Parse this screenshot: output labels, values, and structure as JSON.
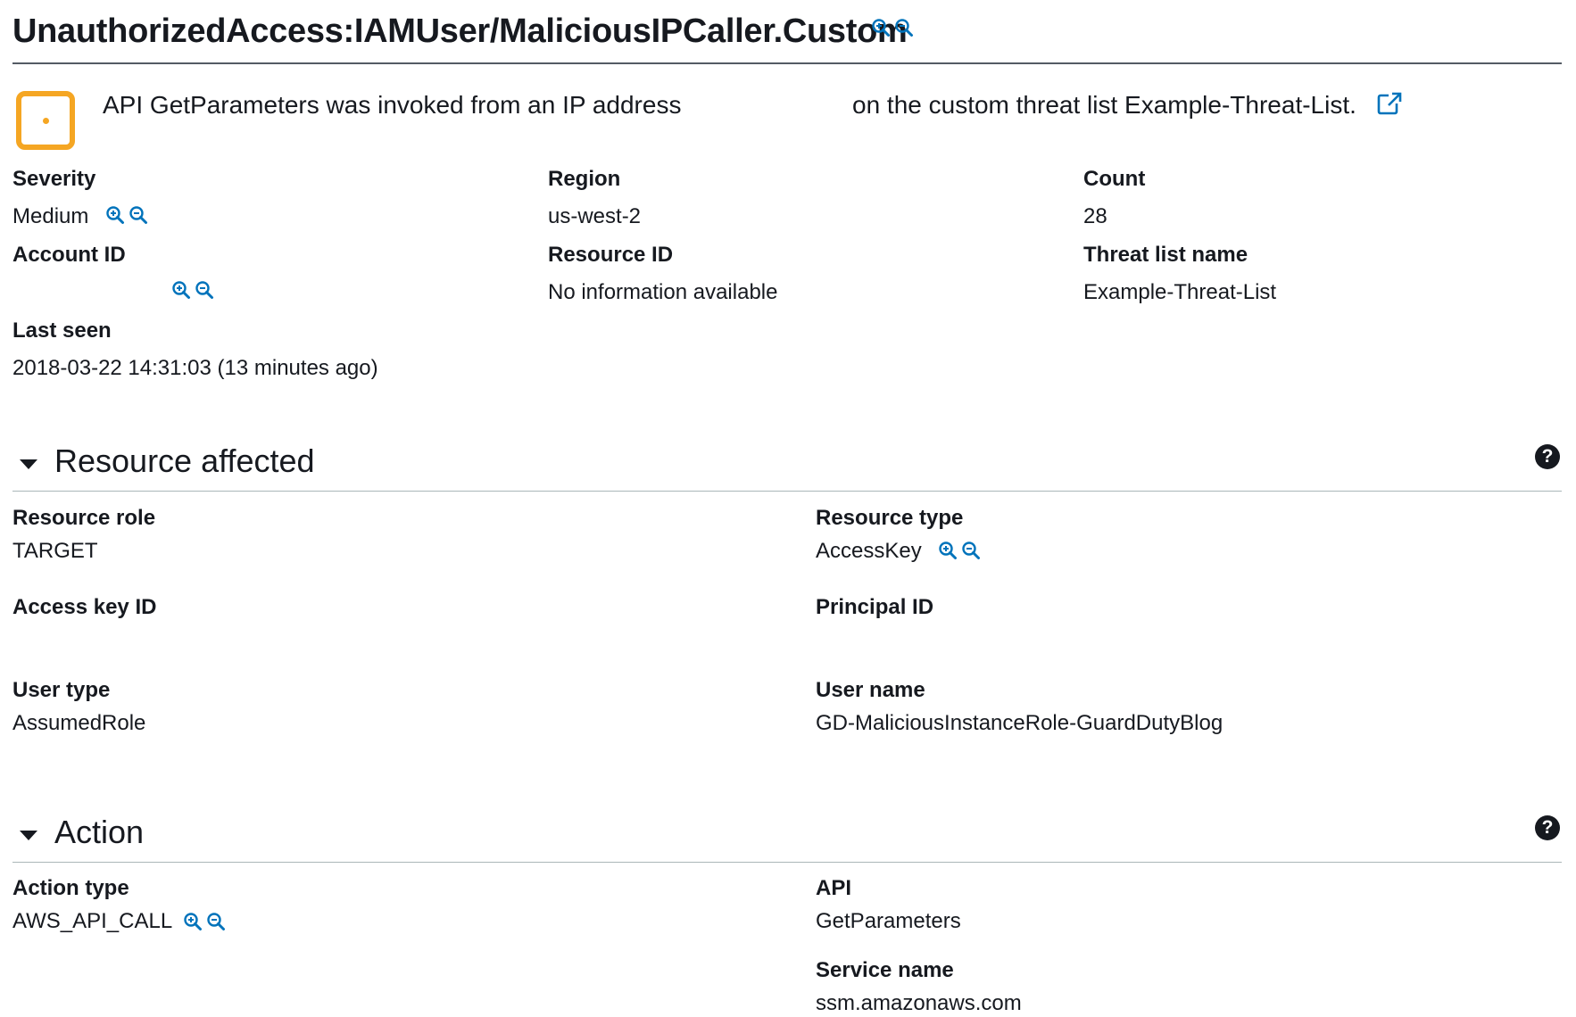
{
  "finding": {
    "title": "UnauthorizedAccess:IAMUser/MaliciousIPCaller.Custom",
    "description_part1": "API GetParameters was invoked from an IP address",
    "description_part2": "on the custom threat list Example-Threat-List.",
    "colors": {
      "severity_medium": "#f5a623",
      "link_blue": "#0073bb"
    }
  },
  "summary": {
    "severity_label": "Severity",
    "severity_value": "Medium",
    "region_label": "Region",
    "region_value": "us-west-2",
    "count_label": "Count",
    "count_value": "28",
    "account_id_label": "Account ID",
    "account_id_value": "",
    "resource_id_label": "Resource ID",
    "resource_id_value": "No information available",
    "threat_list_label": "Threat list name",
    "threat_list_value": "Example-Threat-List",
    "last_seen_label": "Last seen",
    "last_seen_value": "2018-03-22 14:31:03 (13 minutes ago)"
  },
  "resource_section": {
    "title": "Resource affected",
    "help": "?",
    "resource_role_label": "Resource role",
    "resource_role_value": "TARGET",
    "resource_type_label": "Resource type",
    "resource_type_value": "AccessKey",
    "access_key_id_label": "Access key ID",
    "access_key_id_value": "",
    "principal_id_label": "Principal ID",
    "principal_id_value": "",
    "user_type_label": "User type",
    "user_type_value": "AssumedRole",
    "user_name_label": "User name",
    "user_name_value": "GD-MaliciousInstanceRole-GuardDutyBlog"
  },
  "action_section": {
    "title": "Action",
    "help": "?",
    "action_type_label": "Action type",
    "action_type_value": "AWS_API_CALL",
    "api_label": "API",
    "api_value": "GetParameters",
    "service_name_label": "Service name",
    "service_name_value": "ssm.amazonaws.com"
  },
  "icons": {
    "zoom_in": "zoom-in-icon",
    "zoom_out": "zoom-out-icon",
    "external_link": "external-link-icon",
    "severity": "severity-medium-icon",
    "help": "help-icon",
    "caret": "caret-down-icon"
  }
}
